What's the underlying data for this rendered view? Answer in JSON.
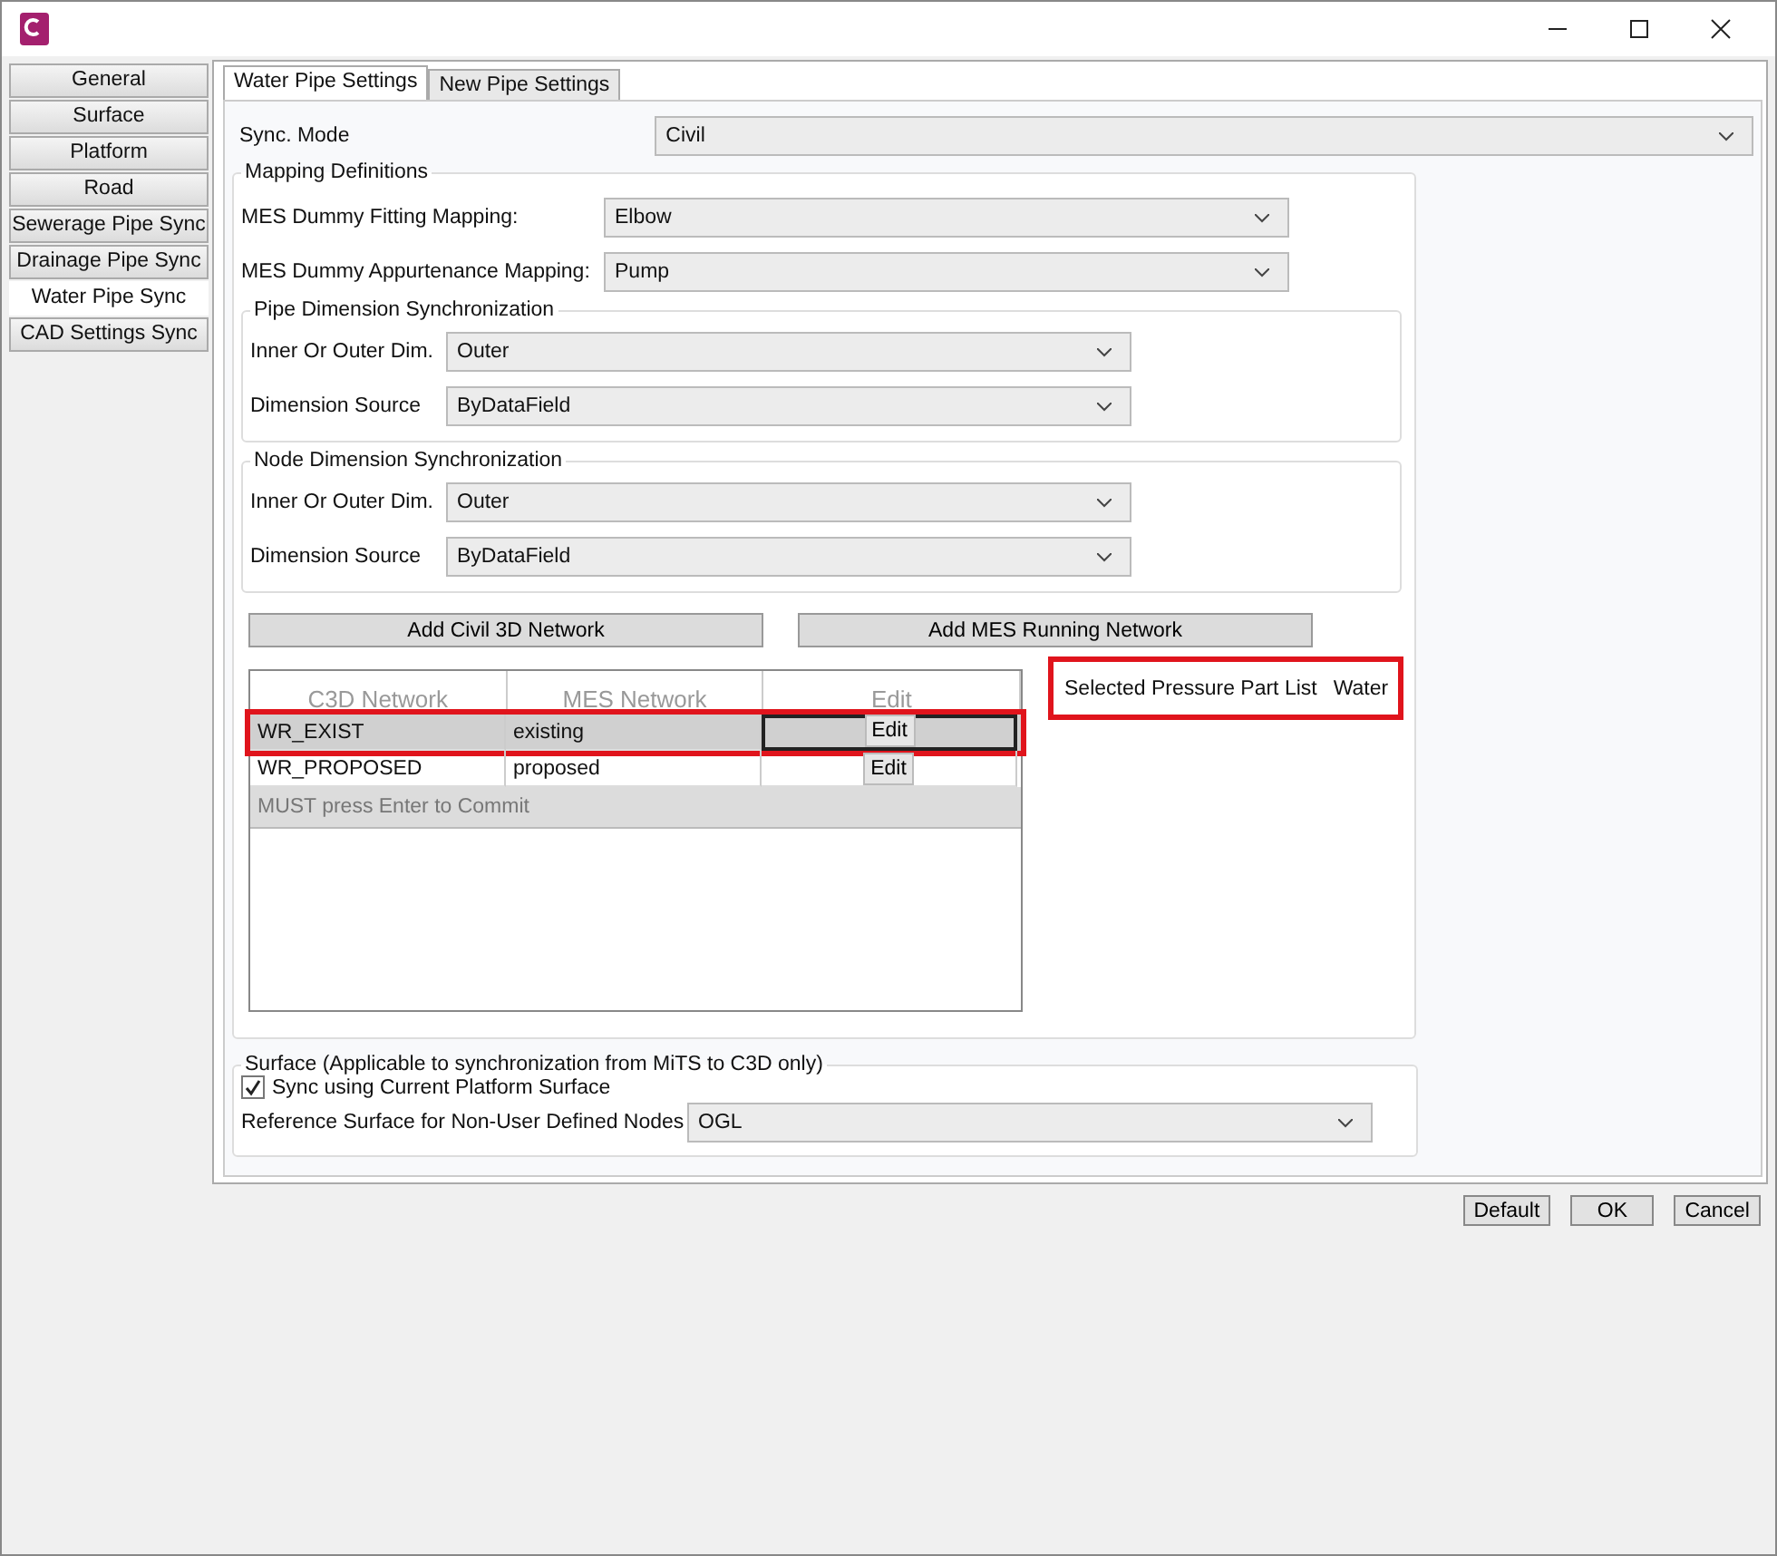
{
  "sidebar": {
    "items": [
      {
        "label": "General",
        "selected": false
      },
      {
        "label": "Surface",
        "selected": false
      },
      {
        "label": "Platform",
        "selected": false
      },
      {
        "label": "Road",
        "selected": false
      },
      {
        "label": "Sewerage Pipe Sync",
        "selected": false
      },
      {
        "label": "Drainage Pipe Sync",
        "selected": false
      },
      {
        "label": "Water Pipe Sync",
        "selected": true
      },
      {
        "label": "CAD Settings Sync",
        "selected": false
      }
    ]
  },
  "tabs": [
    {
      "label": "Water Pipe Settings",
      "selected": true
    },
    {
      "label": "New Pipe Settings",
      "selected": false
    }
  ],
  "sync_mode": {
    "label": "Sync. Mode",
    "value": "Civil"
  },
  "mapping": {
    "title": "Mapping Definitions",
    "fields": [
      {
        "label": "MES Dummy Fitting Mapping:",
        "value": "Elbow"
      },
      {
        "label": "MES Dummy Appurtenance Mapping:",
        "value": "Pump"
      }
    ],
    "groups": [
      {
        "title": "Pipe Dimension Synchronization",
        "fields": [
          {
            "label": "Inner Or Outer Dim.",
            "value": "Outer"
          },
          {
            "label": "Dimension Source",
            "value": "ByDataField"
          }
        ]
      },
      {
        "title": "Node Dimension Synchronization",
        "fields": [
          {
            "label": "Inner Or Outer Dim.",
            "value": "Outer"
          },
          {
            "label": "Dimension Source",
            "value": "ByDataField"
          }
        ]
      }
    ],
    "buttons": [
      "Add Civil 3D Network",
      "Add MES Running Network"
    ],
    "table": {
      "columns": [
        "C3D Network",
        "MES Network",
        "Edit"
      ],
      "rows": [
        {
          "c3d": "WR_EXIST",
          "mes": "existing",
          "edit": "Edit",
          "selected": true,
          "highlighted": true
        },
        {
          "c3d": "WR_PROPOSED",
          "mes": "proposed",
          "edit": "Edit",
          "selected": false,
          "highlighted": false
        }
      ],
      "new_row": "MUST press Enter to Commit"
    },
    "part_list": {
      "label": "Selected Pressure Part List",
      "value": "Water",
      "highlighted": true
    }
  },
  "surface": {
    "title": "Surface (Applicable to synchronization from MiTS to C3D only)",
    "checkbox": {
      "label": "Sync using Current Platform Surface",
      "checked": true
    },
    "reference": {
      "label": "Reference Surface for Non-User Defined Nodes",
      "value": "OGL"
    }
  },
  "buttons": [
    "Default",
    "OK",
    "Cancel"
  ]
}
